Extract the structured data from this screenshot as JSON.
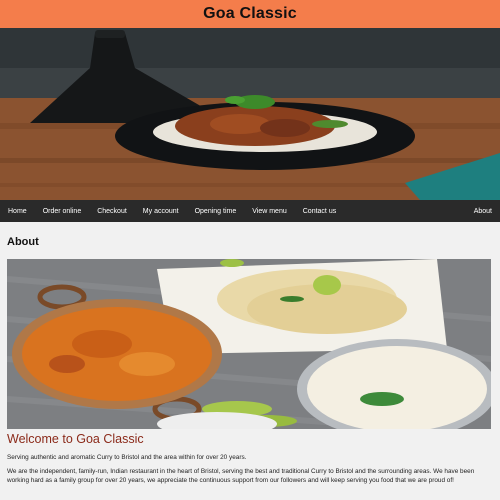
{
  "header": {
    "title": "Goa Classic"
  },
  "colors": {
    "header_bg": "#f47d4b",
    "nav_bg": "#2a2a2a",
    "welcome_text": "#8b2a1a"
  },
  "nav": {
    "items": [
      "Home",
      "Order online",
      "Checkout",
      "My account",
      "Opening time",
      "View menu",
      "Contact us"
    ],
    "right_item": "About"
  },
  "about": {
    "heading": "About",
    "welcome": "Welcome to Goa Classic",
    "line1": "Serving authentic and aromatic Curry to Bristol and the area within for over 20 years.",
    "paragraph": "We are the independent, family-run, Indian restaurant in the heart of Bristol, serving the best and traditional Curry to Bristol and the surrounding areas. We have been working hard as a family group for over 20 years, we appreciate the continuous support from our followers and will keep serving you food that we are proud of!"
  }
}
